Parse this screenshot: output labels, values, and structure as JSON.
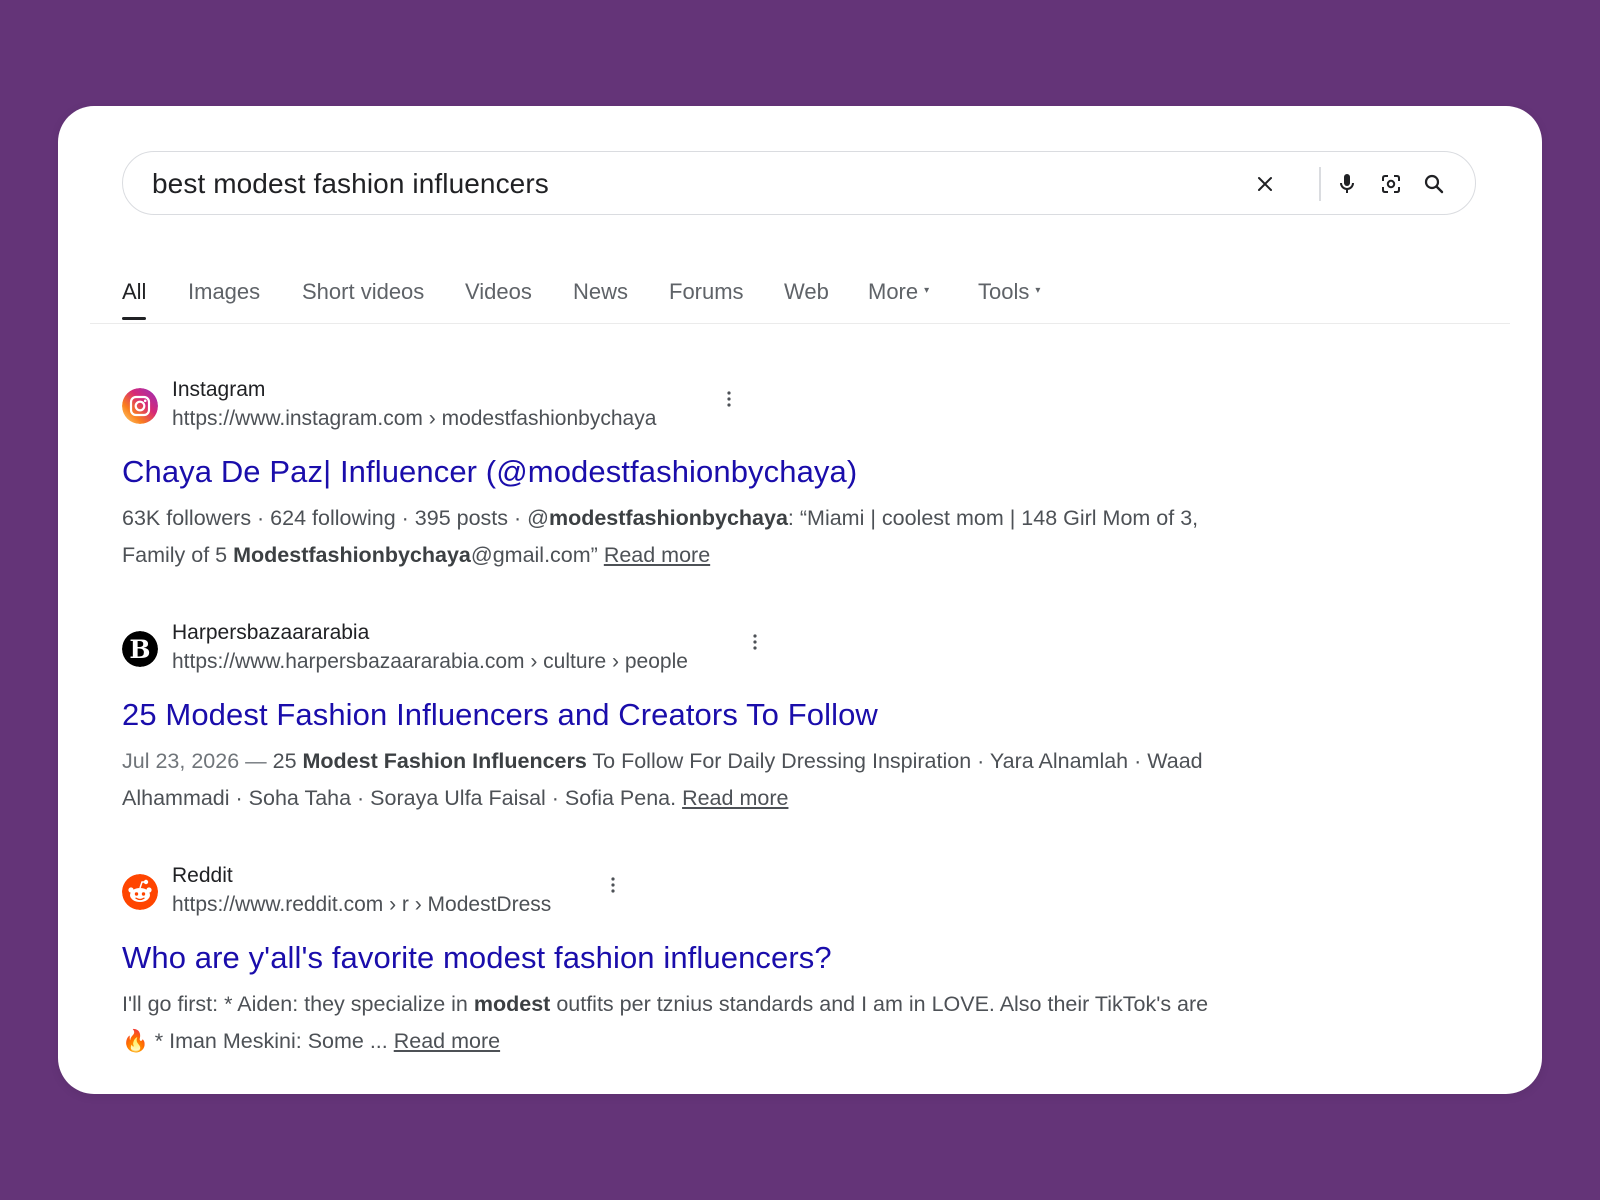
{
  "search": {
    "query": "best modest fashion influencers",
    "icons": [
      "close-icon",
      "microphone-icon",
      "lens-icon",
      "search-icon"
    ]
  },
  "tabs": [
    {
      "label": "All",
      "active": true
    },
    {
      "label": "Images"
    },
    {
      "label": "Short videos"
    },
    {
      "label": "Videos"
    },
    {
      "label": "News"
    },
    {
      "label": "Forums"
    },
    {
      "label": "Web"
    },
    {
      "label": "More",
      "has_caret": true
    },
    {
      "label": "Tools",
      "has_caret": true
    }
  ],
  "results": [
    {
      "site_name": "Instagram",
      "url": "https://www.instagram.com › modestfashionbychaya",
      "title": "Chaya De Paz| Influencer (@modestfashionbychaya)",
      "snippet": {
        "p1": "63K followers · 624 following · 395 posts · @",
        "b1": "modestfashionbychaya",
        "p2": ": “Miami | coolest mom | 148 Girl Mom of 3, Family of 5 ",
        "b2": "Modestfashionbychaya",
        "p3": "@gmail.com” "
      },
      "read_more": "Read more",
      "favicon": "instagram-icon"
    },
    {
      "site_name": "Harpersbazaararabia",
      "url": "https://www.harpersbazaararabia.com › culture › people",
      "title": "25 Modest Fashion Influencers and Creators To Follow",
      "snippet": {
        "date": "Jul 23, 2026 — ",
        "p1": "25 ",
        "b1": "Modest Fashion Influencers",
        "p2": " To Follow For Daily Dressing Inspiration · Yara Alnamlah · Waad Alhammadi · Soha Taha · Soraya Ulfa Faisal · Sofia Pena. "
      },
      "read_more": "Read more",
      "favicon": "harpers-bazaar-icon"
    },
    {
      "site_name": "Reddit",
      "url": "https://www.reddit.com › r › ModestDress",
      "title": "Who are y'all's favorite modest fashion influencers?",
      "snippet": {
        "p1": "I'll go first: * Aiden: they specialize in ",
        "b1": "modest",
        "p2": " outfits per tznius standards and I am in LOVE. Also their TikTok's are ",
        "emoji": "🔥",
        "p3": " * Iman Meskini: Some ... "
      },
      "read_more": "Read more",
      "favicon": "reddit-icon"
    }
  ],
  "colors": {
    "background": "#643478",
    "link": "#1a0dab",
    "text": "#4d5156"
  }
}
